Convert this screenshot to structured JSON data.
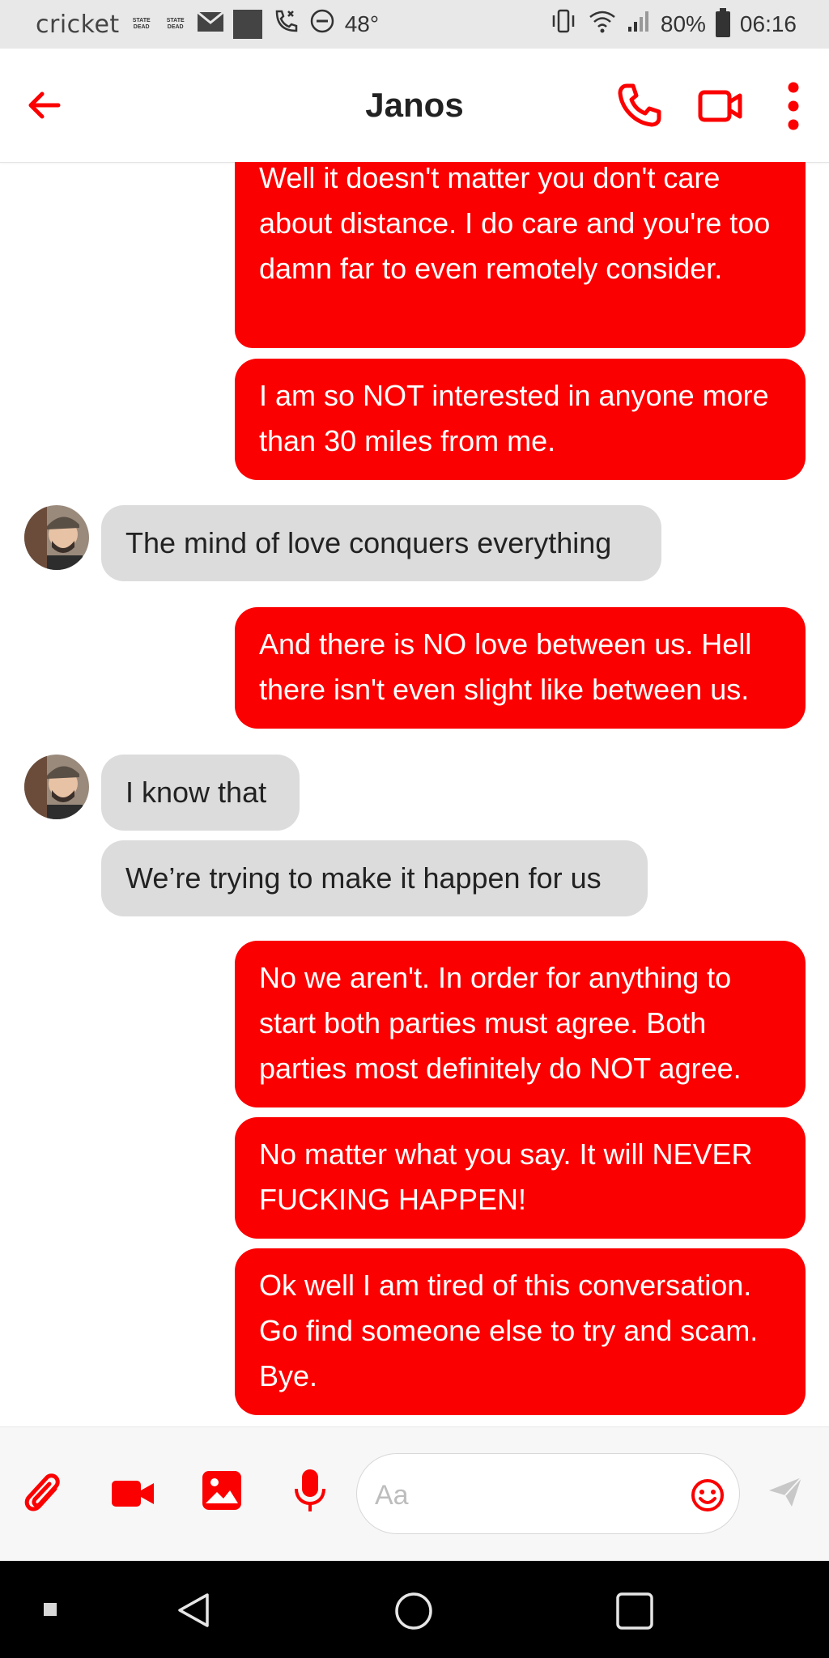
{
  "status_bar": {
    "carrier": "cricket",
    "logo_top": "STATE",
    "logo_bottom": "DEAD",
    "temperature": "48°",
    "battery": "80%",
    "time": "06:16",
    "icons": [
      "mail-icon",
      "gallery-icon",
      "missed-call-icon",
      "dnd-icon",
      "vibrate-icon",
      "wifi-icon",
      "signal-icon",
      "battery-icon"
    ]
  },
  "header": {
    "title": "Janos",
    "accent_color": "#fb0000",
    "icons": [
      "back-arrow-icon",
      "phone-icon",
      "video-camera-icon",
      "more-vertical-icon"
    ]
  },
  "messages": [
    {
      "sender": "me",
      "text": "Well it doesn't matter you don't care about distance. I do care and you're too damn far to even remotely consider."
    },
    {
      "sender": "me",
      "text": "I am so NOT interested in anyone more than 30 miles from me."
    },
    {
      "sender": "Janos",
      "text": "The mind of love conquers everything"
    },
    {
      "sender": "me",
      "text": "And there is NO love between us. Hell there isn't even slight like between us."
    },
    {
      "sender": "Janos",
      "text": "I know that"
    },
    {
      "sender": "Janos",
      "text": "We’re trying to make it happen for us"
    },
    {
      "sender": "me",
      "text": "No we aren't. In order for anything to start both parties must agree. Both parties most definitely do NOT agree."
    },
    {
      "sender": "me",
      "text": "No matter what you say. It will NEVER FUCKING HAPPEN!"
    },
    {
      "sender": "me",
      "text": "Ok well I am tired of this conversation. Go find someone else to try and scam.  Bye."
    }
  ],
  "composer": {
    "placeholder": "Aa",
    "value": "",
    "icons": [
      "attachment-icon",
      "video-icon",
      "image-icon",
      "microphone-icon",
      "emoji-icon",
      "send-icon"
    ]
  },
  "nav_bar": {
    "icons": [
      "recents-dot-icon",
      "back-triangle-icon",
      "home-circle-icon",
      "overview-square-icon"
    ]
  }
}
